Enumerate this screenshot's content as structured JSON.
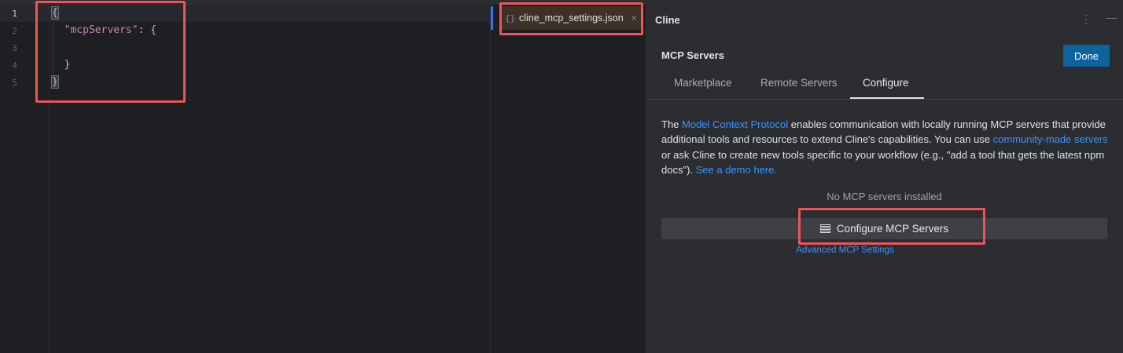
{
  "editor": {
    "lines": [
      {
        "num": "1",
        "text": "{"
      },
      {
        "num": "2",
        "key": "\"mcpServers\"",
        "rest": ": {"
      },
      {
        "num": "3",
        "text": ""
      },
      {
        "num": "4",
        "text": "  }"
      },
      {
        "num": "5",
        "text": "}"
      }
    ]
  },
  "file_tab": {
    "icon": "{}",
    "label": "cline_mcp_settings.json",
    "close": "×"
  },
  "cline": {
    "title": "Cline",
    "more_icon": "⋮",
    "minimize_icon": "—",
    "mcp_title": "MCP Servers",
    "done_label": "Done",
    "tabs": [
      "Marketplace",
      "Remote Servers",
      "Configure"
    ],
    "active_tab": "Configure",
    "description": {
      "p1": "The ",
      "link1": "Model Context Protocol",
      "p2": " enables communication with locally running MCP servers that provide additional tools and resources to extend Cline's capabilities. You can use ",
      "link2": "community-made servers",
      "p3": " or ask Cline to create new tools specific to your workflow (e.g., \"add a tool that gets the latest npm docs\"). ",
      "link3": "See a demo here."
    },
    "no_servers": "No MCP servers installed",
    "configure_button": "Configure MCP Servers",
    "advanced_link": "Advanced MCP Settings"
  },
  "colors": {
    "accent": "#0e639c",
    "link": "#3794ff",
    "annotation": "#f0535a"
  }
}
